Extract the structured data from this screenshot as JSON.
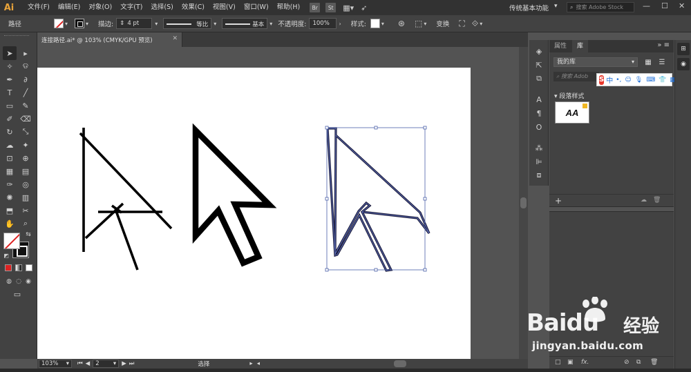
{
  "menubar": {
    "logo": "Ai",
    "items": [
      "文件(F)",
      "编辑(E)",
      "对象(O)",
      "文字(T)",
      "选择(S)",
      "效果(C)",
      "视图(V)",
      "窗口(W)",
      "帮助(H)"
    ],
    "bridge": "Br",
    "stock": "St",
    "workspace": "传统基本功能",
    "stock_search_placeholder": "搜索 Adobe Stock"
  },
  "control_bar": {
    "object_type": "路径",
    "stroke_label": "描边:",
    "stroke_weight": "4 pt",
    "profile_label": "等比",
    "brush_label": "基本",
    "opacity_label": "不透明度:",
    "opacity_value": "100%",
    "style_label": "样式:",
    "transform_label": "变换"
  },
  "document": {
    "tab_title": "连接路径.ai* @ 103% (CMYK/GPU 预览)"
  },
  "status_bar": {
    "zoom": "103%",
    "page": "2",
    "tool_status": "选择"
  },
  "panel": {
    "tabs": [
      "属性",
      "库"
    ],
    "active_tab": "库",
    "library": "我的库",
    "search_placeholder": "搜索 Adob",
    "group_title": "段落样式",
    "style_thumb_text": "AA"
  },
  "ime": {
    "logo": "S",
    "mode": "中"
  },
  "watermark": {
    "brand": "Bai",
    "brand_du": "du",
    "suffix_cn": "经验",
    "url": "jingyan.baidu.com"
  },
  "colors": {
    "accent": "#e8a33a",
    "selection": "#4a5fa8",
    "stroke": "#000000"
  }
}
